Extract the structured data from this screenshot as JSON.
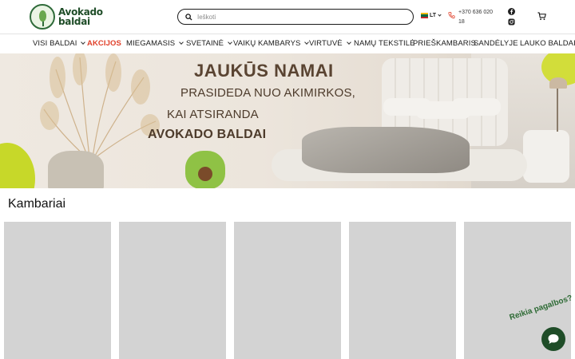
{
  "brand": {
    "line1": "Avokado",
    "line2": "baldai"
  },
  "search": {
    "placeholder": "Ieškoti"
  },
  "language": {
    "code": "LT"
  },
  "phone": {
    "text": "+370 636 020 18"
  },
  "nav": [
    {
      "label": "VISI BALDAI",
      "dropdown": true,
      "promo": false
    },
    {
      "label": "AKCIJOS",
      "dropdown": false,
      "promo": true
    },
    {
      "label": "MIEGAMASIS",
      "dropdown": true,
      "promo": false
    },
    {
      "label": "SVETAINĖ",
      "dropdown": true,
      "promo": false
    },
    {
      "label": "VAIKŲ KAMBARYS",
      "dropdown": true,
      "promo": false
    },
    {
      "label": "VIRTUVĖ",
      "dropdown": true,
      "promo": false
    },
    {
      "label": "NAMŲ TEKSTILĖ",
      "dropdown": false,
      "promo": false
    },
    {
      "label": "PRIEŠKAMBARIS",
      "dropdown": false,
      "promo": false
    },
    {
      "label": "SANDĖLYJE",
      "dropdown": false,
      "promo": false
    },
    {
      "label": "LAUKO BALDAI",
      "dropdown": false,
      "promo": false
    }
  ],
  "hero": {
    "line1": "JAUKŪS NAMAI",
    "line2": "PRASIDEDA NUO AKIMIRKOS,",
    "line3": "KAI ATSIRANDA",
    "line4": "AVOKADO BALDAI"
  },
  "section": {
    "title": "Kambariai"
  },
  "chat": {
    "help_text": "Reikia pagalbos?",
    "close_glyph": ""
  },
  "colors": {
    "brand_green": "#1f4d28",
    "promo_red": "#e0402a",
    "accent_lime": "#c7d829",
    "card_placeholder": "#d3d3d3"
  }
}
